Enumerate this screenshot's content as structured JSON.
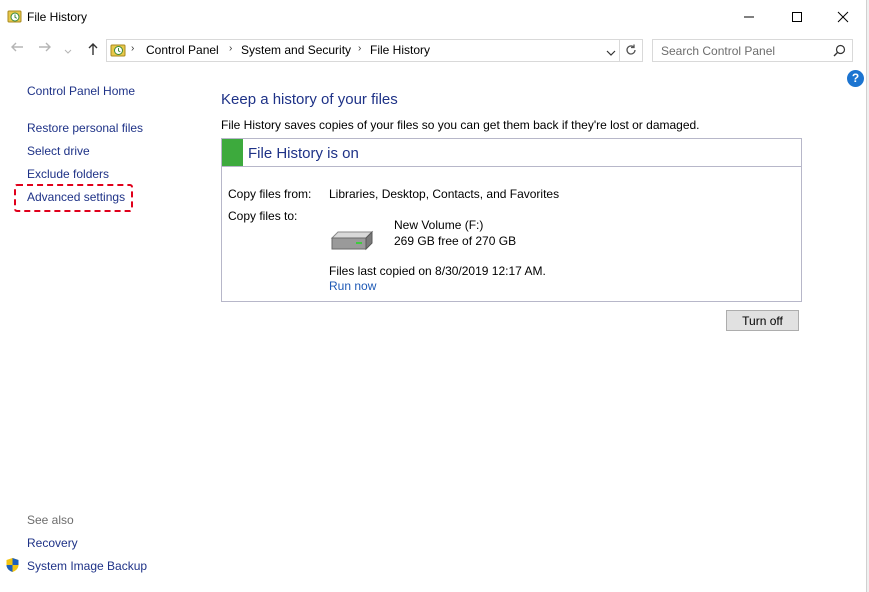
{
  "window": {
    "title": "File History"
  },
  "address_bar": {
    "breadcrumbs": [
      "Control Panel",
      "System and Security",
      "File History"
    ]
  },
  "search": {
    "placeholder": "Search Control Panel"
  },
  "sidebar": {
    "home": "Control Panel Home",
    "items": [
      {
        "label": "Restore personal files"
      },
      {
        "label": "Select drive"
      },
      {
        "label": "Exclude folders"
      },
      {
        "label": "Advanced settings"
      }
    ],
    "see_also_title": "See also",
    "see_also": [
      {
        "label": "Recovery"
      },
      {
        "label": "System Image Backup"
      }
    ]
  },
  "main": {
    "title": "Keep a history of your files",
    "description": "File History saves copies of your files so you can get them back if they're lost or damaged.",
    "status_title": "File History is on",
    "copy_from_label": "Copy files from:",
    "copy_from_value": "Libraries, Desktop, Contacts, and Favorites",
    "copy_to_label": "Copy files to:",
    "drive_name": "New Volume (F:)",
    "drive_space": "269 GB free of 270 GB",
    "last_copied": "Files last copied on 8/30/2019 12:17 AM.",
    "run_now": "Run now",
    "turn_off": "Turn off"
  },
  "colors": {
    "link": "#1e3287",
    "status_green": "#3daa3d",
    "highlight": "#e0001b"
  },
  "icons": [
    "file-history-icon",
    "back-arrow-icon",
    "forward-arrow-icon",
    "up-arrow-icon",
    "refresh-icon",
    "search-icon",
    "help-icon",
    "drive-icon",
    "shield-icon"
  ]
}
